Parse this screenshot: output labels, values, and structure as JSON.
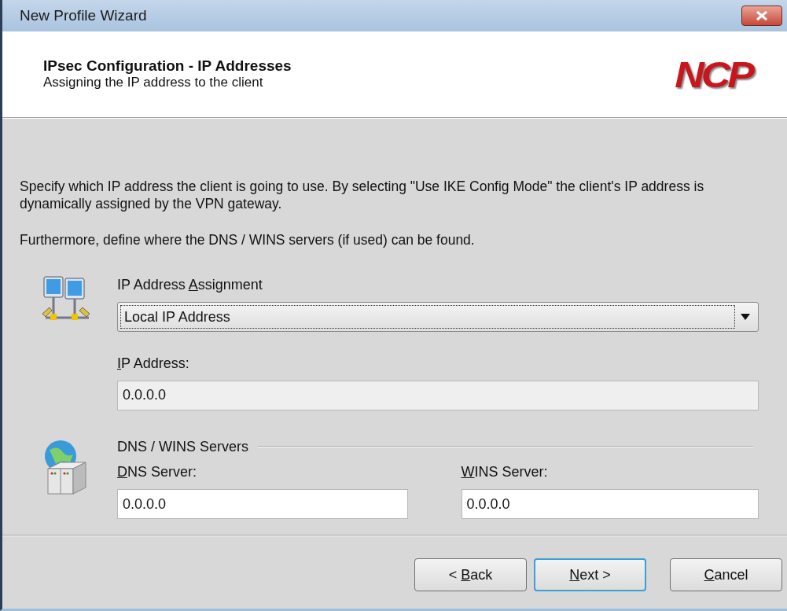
{
  "window": {
    "title": "New Profile Wizard"
  },
  "header": {
    "title": "IPsec Configuration - IP Addresses",
    "subtitle": "Assigning the IP address to the client",
    "logo": "NCP"
  },
  "intro": [
    "Specify which IP address the client is going to use. By selecting \"Use IKE Config Mode\" the client's IP address is dynamically assigned by the VPN gateway.",
    "Furthermore, define where the DNS / WINS servers (if used) can be found."
  ],
  "assignment": {
    "label": {
      "before": "IP Address ",
      "key": "A",
      "after": "ssignment"
    },
    "value": "Local IP Address",
    "focused": true,
    "ip_label": {
      "key": "I",
      "after": "P Address:"
    },
    "ip_value": "0.0.0.0",
    "ip_disabled": true
  },
  "servers": {
    "group_label": "DNS / WINS Servers",
    "fields": [
      {
        "label": {
          "key": "D",
          "after": "NS Server:"
        },
        "value": "0.0.0.0",
        "disabled": false
      },
      {
        "label": {
          "key": "W",
          "after": "INS Server:"
        },
        "value": "0.0.0.0",
        "disabled": false
      }
    ]
  },
  "buttons": [
    {
      "label": {
        "before": "< ",
        "key": "B",
        "after": "ack"
      },
      "default": false
    },
    {
      "label": {
        "key": "N",
        "after": "ext >"
      },
      "default": true
    },
    {
      "label": {
        "key": "C",
        "after": "ancel"
      },
      "default": false
    }
  ]
}
